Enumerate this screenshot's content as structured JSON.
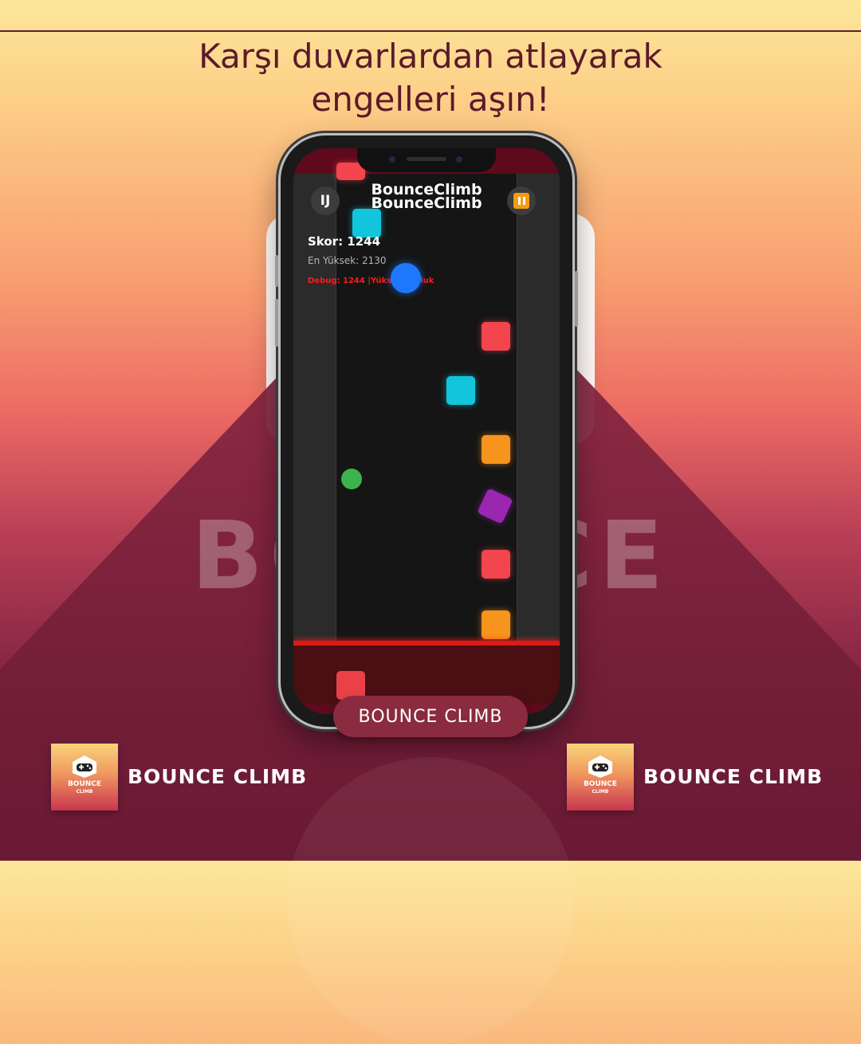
{
  "headline": {
    "line1": "Karşı duvarlardan atlayarak",
    "line2": "engelleri aşın!"
  },
  "watermark": "BOUNCE",
  "game": {
    "title": "BounceClimb",
    "left_button_label": "IJ",
    "pause_icon": "pause-icon",
    "score_text": "Skor: 1244",
    "best_text": "En Yüksek: 2130",
    "debug_text": "Debug: 1244 |Yüksek Zorluk"
  },
  "pill_label": "BOUNCE CLIMB",
  "logo": {
    "icon": "gamepad-icon",
    "line1": "BOUNCE",
    "line2": "CLIMB"
  },
  "brand_left": "BOUNCE CLIMB",
  "brand_right": "BOUNCE CLIMB",
  "colors": {
    "headline": "#5c1a2a",
    "red_block": "#f2454d",
    "cyan_block": "#12c4dc",
    "orange_block": "#f7941d",
    "purple_block": "#9b27b0",
    "blue_ball": "#1e78ff",
    "green_ball": "#3cb44b"
  }
}
